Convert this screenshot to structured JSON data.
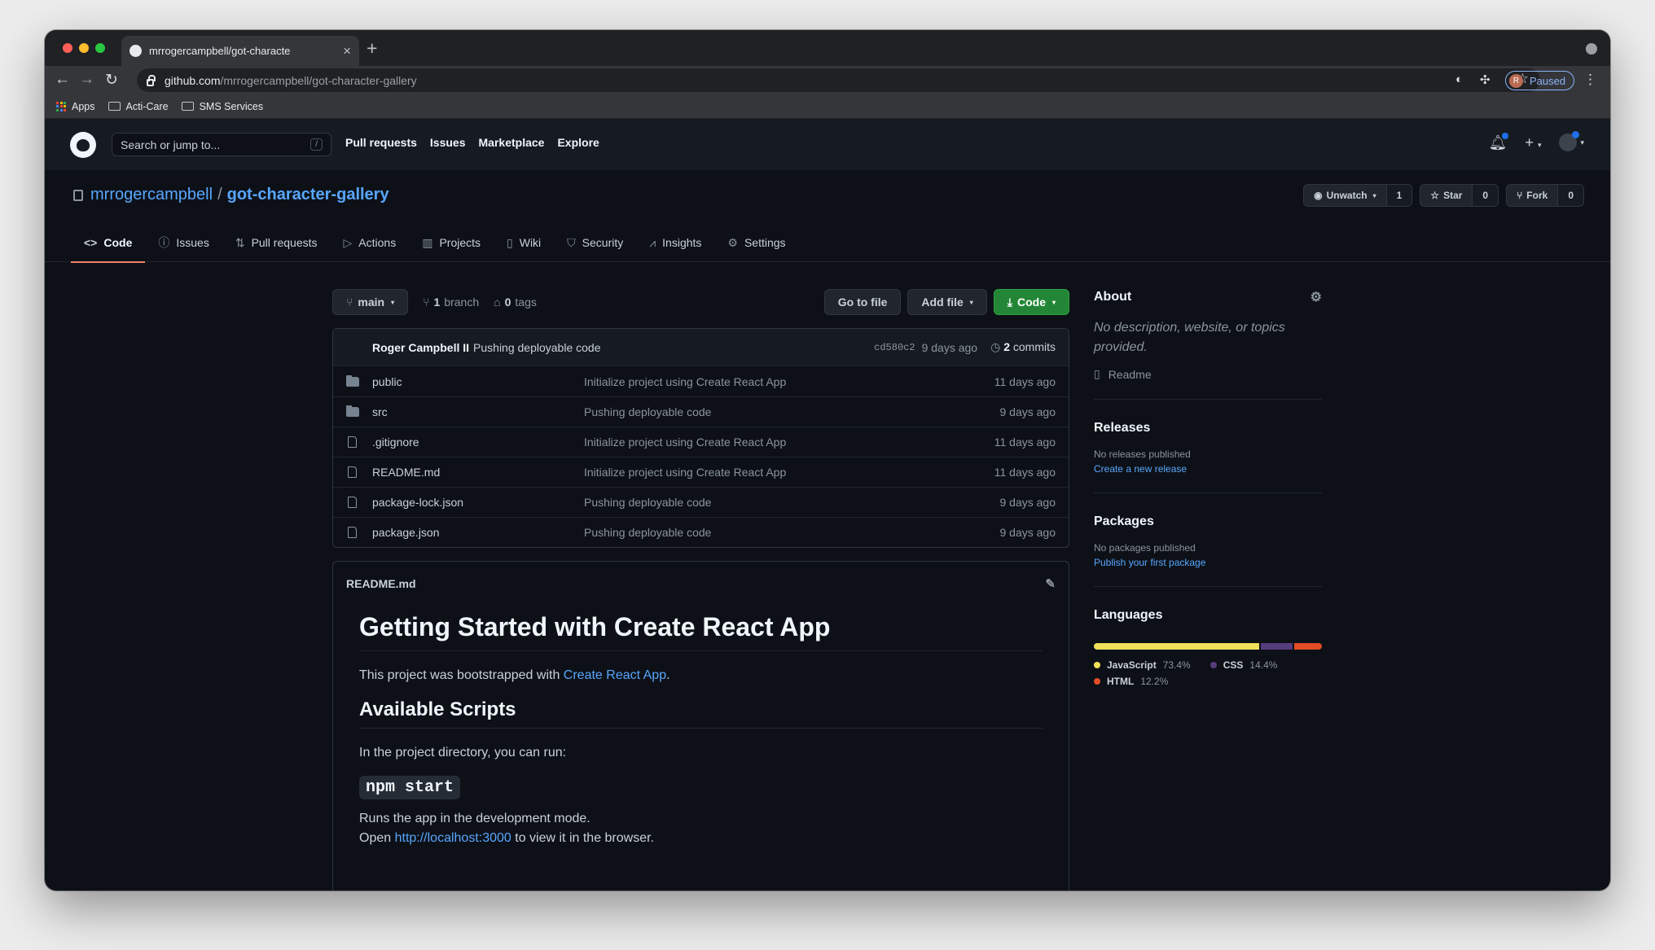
{
  "browser": {
    "tab_title": "mrrogercampbell/got-characte",
    "url_host": "github.com",
    "url_path": "/mrrogercampbell/got-character-gallery",
    "profile_initial": "R",
    "profile_status": "Paused",
    "bookmarks": [
      {
        "label": "Apps",
        "icon": "apps-grid-icon"
      },
      {
        "label": "Acti-Care",
        "icon": "folder-icon"
      },
      {
        "label": "SMS Services",
        "icon": "folder-icon"
      }
    ]
  },
  "header": {
    "search_placeholder": "Search or jump to...",
    "search_shortcut": "/",
    "nav": [
      "Pull requests",
      "Issues",
      "Marketplace",
      "Explore"
    ]
  },
  "repo": {
    "owner": "mrrogercampbell",
    "separator": "/",
    "name": "got-character-gallery",
    "watch_label": "Unwatch",
    "watch_count": "1",
    "star_label": "Star",
    "star_count": "0",
    "fork_label": "Fork",
    "fork_count": "0",
    "tabs": [
      {
        "label": "Code",
        "icon": "code-icon"
      },
      {
        "label": "Issues",
        "icon": "issue-icon"
      },
      {
        "label": "Pull requests",
        "icon": "pull-request-icon"
      },
      {
        "label": "Actions",
        "icon": "play-icon"
      },
      {
        "label": "Projects",
        "icon": "project-icon"
      },
      {
        "label": "Wiki",
        "icon": "book-icon"
      },
      {
        "label": "Security",
        "icon": "shield-icon"
      },
      {
        "label": "Insights",
        "icon": "graph-icon"
      },
      {
        "label": "Settings",
        "icon": "gear-icon"
      }
    ]
  },
  "filenav": {
    "branch": "main",
    "branch_count": "1",
    "branch_word": "branch",
    "tag_count": "0",
    "tag_word": "tags",
    "go_to_file": "Go to file",
    "add_file": "Add file",
    "code": "Code"
  },
  "commit": {
    "author": "Roger Campbell II",
    "message": "Pushing deployable code",
    "sha": "cd580c2",
    "ago": "9 days ago",
    "count": "2",
    "count_word": "commits"
  },
  "files": [
    {
      "type": "dir",
      "name": "public",
      "message": "Initialize project using Create React App",
      "age": "11 days ago"
    },
    {
      "type": "dir",
      "name": "src",
      "message": "Pushing deployable code",
      "age": "9 days ago"
    },
    {
      "type": "file",
      "name": ".gitignore",
      "message": "Initialize project using Create React App",
      "age": "11 days ago"
    },
    {
      "type": "file",
      "name": "README.md",
      "message": "Initialize project using Create React App",
      "age": "11 days ago"
    },
    {
      "type": "file",
      "name": "package-lock.json",
      "message": "Pushing deployable code",
      "age": "9 days ago"
    },
    {
      "type": "file",
      "name": "package.json",
      "message": "Pushing deployable code",
      "age": "9 days ago"
    }
  ],
  "readme": {
    "filename": "README.md",
    "h1": "Getting Started with Create React App",
    "p1_before": "This project was bootstrapped with ",
    "p1_link": "Create React App",
    "p1_after": ".",
    "h2": "Available Scripts",
    "p2": "In the project directory, you can run:",
    "code": "npm start",
    "p3_line1": "Runs the app in the development mode.",
    "p3_before": "Open ",
    "p3_link": "http://localhost:3000",
    "p3_after": " to view it in the browser."
  },
  "about": {
    "title": "About",
    "description": "No description, website, or topics provided.",
    "readme_label": "Readme"
  },
  "releases": {
    "title": "Releases",
    "status": "No releases published",
    "link": "Create a new release"
  },
  "packages": {
    "title": "Packages",
    "status": "No packages published",
    "link": "Publish your first package"
  },
  "languages": {
    "title": "Languages",
    "items": [
      {
        "name": "JavaScript",
        "percent": "73.4%",
        "value": 73.4,
        "color": "#f1e05a"
      },
      {
        "name": "CSS",
        "percent": "14.4%",
        "value": 14.4,
        "color": "#563d7c"
      },
      {
        "name": "HTML",
        "percent": "12.2%",
        "value": 12.2,
        "color": "#e34c26"
      }
    ]
  },
  "colors": {
    "accent_link": "#58a6ff",
    "active_tab_underline": "#f78166",
    "code_button": "#238636"
  }
}
